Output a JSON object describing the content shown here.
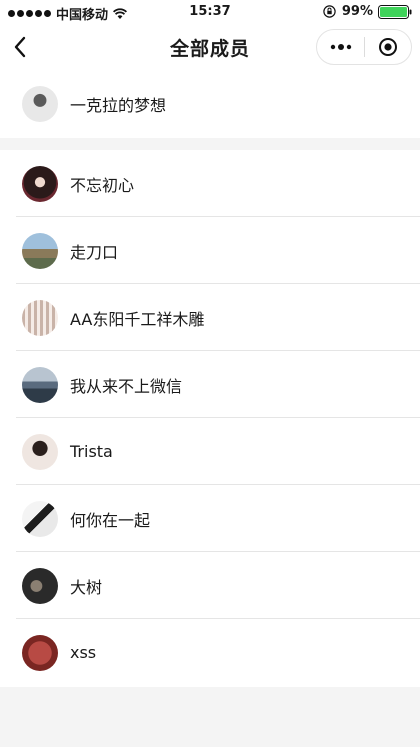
{
  "status_bar": {
    "carrier": "中国移动",
    "time": "15:37",
    "battery": "99%"
  },
  "nav": {
    "title": "全部成员",
    "back_icon": "chevron-left-icon",
    "more_icon": "more-dots-icon",
    "close_icon": "target-icon"
  },
  "owner": {
    "name": "一克拉的梦想",
    "avatar": "avatar-bw-photo"
  },
  "members": [
    {
      "name": "不忘初心",
      "avatar": "avatar-girl-portrait"
    },
    {
      "name": "走刀口",
      "avatar": "avatar-street-scene"
    },
    {
      "name": "AA东阳千工祥木雕",
      "avatar": "avatar-woodcarving"
    },
    {
      "name": "我从来不上微信",
      "avatar": "avatar-lake-landscape"
    },
    {
      "name": "Trista",
      "avatar": "avatar-woman-portrait"
    },
    {
      "name": "何你在一起",
      "avatar": "avatar-sketch"
    },
    {
      "name": "大树",
      "avatar": "avatar-dark-photo"
    },
    {
      "name": "xss",
      "avatar": "avatar-red-texture"
    }
  ]
}
